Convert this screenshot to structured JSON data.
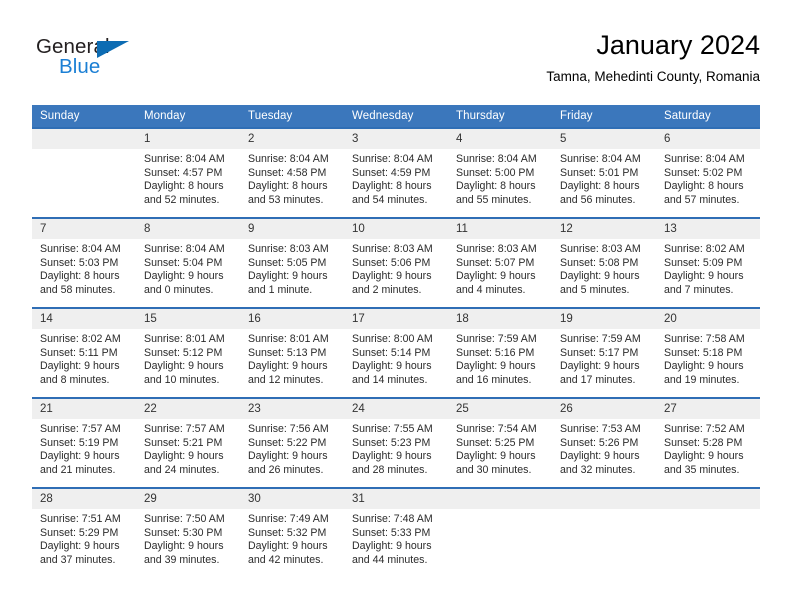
{
  "brand": {
    "name_part1": "General",
    "name_part2": "Blue",
    "triangle_color": "#0d6cb3",
    "blue_color": "#1b7fd4"
  },
  "header": {
    "title": "January 2024",
    "subtitle": "Tamna, Mehedinti County, Romania"
  },
  "theme": {
    "header_band": "#3b77bc",
    "row_rule": "#2f6eb5",
    "daynum_band": "#efefef"
  },
  "weekday_headers": [
    "Sunday",
    "Monday",
    "Tuesday",
    "Wednesday",
    "Thursday",
    "Friday",
    "Saturday"
  ],
  "weeks": [
    [
      {
        "day": "",
        "sunrise": "",
        "sunset": "",
        "daylight1": "",
        "daylight2": "",
        "empty": true
      },
      {
        "day": "1",
        "sunrise": "Sunrise: 8:04 AM",
        "sunset": "Sunset: 4:57 PM",
        "daylight1": "Daylight: 8 hours",
        "daylight2": "and 52 minutes."
      },
      {
        "day": "2",
        "sunrise": "Sunrise: 8:04 AM",
        "sunset": "Sunset: 4:58 PM",
        "daylight1": "Daylight: 8 hours",
        "daylight2": "and 53 minutes."
      },
      {
        "day": "3",
        "sunrise": "Sunrise: 8:04 AM",
        "sunset": "Sunset: 4:59 PM",
        "daylight1": "Daylight: 8 hours",
        "daylight2": "and 54 minutes."
      },
      {
        "day": "4",
        "sunrise": "Sunrise: 8:04 AM",
        "sunset": "Sunset: 5:00 PM",
        "daylight1": "Daylight: 8 hours",
        "daylight2": "and 55 minutes."
      },
      {
        "day": "5",
        "sunrise": "Sunrise: 8:04 AM",
        "sunset": "Sunset: 5:01 PM",
        "daylight1": "Daylight: 8 hours",
        "daylight2": "and 56 minutes."
      },
      {
        "day": "6",
        "sunrise": "Sunrise: 8:04 AM",
        "sunset": "Sunset: 5:02 PM",
        "daylight1": "Daylight: 8 hours",
        "daylight2": "and 57 minutes."
      }
    ],
    [
      {
        "day": "7",
        "sunrise": "Sunrise: 8:04 AM",
        "sunset": "Sunset: 5:03 PM",
        "daylight1": "Daylight: 8 hours",
        "daylight2": "and 58 minutes."
      },
      {
        "day": "8",
        "sunrise": "Sunrise: 8:04 AM",
        "sunset": "Sunset: 5:04 PM",
        "daylight1": "Daylight: 9 hours",
        "daylight2": "and 0 minutes."
      },
      {
        "day": "9",
        "sunrise": "Sunrise: 8:03 AM",
        "sunset": "Sunset: 5:05 PM",
        "daylight1": "Daylight: 9 hours",
        "daylight2": "and 1 minute."
      },
      {
        "day": "10",
        "sunrise": "Sunrise: 8:03 AM",
        "sunset": "Sunset: 5:06 PM",
        "daylight1": "Daylight: 9 hours",
        "daylight2": "and 2 minutes."
      },
      {
        "day": "11",
        "sunrise": "Sunrise: 8:03 AM",
        "sunset": "Sunset: 5:07 PM",
        "daylight1": "Daylight: 9 hours",
        "daylight2": "and 4 minutes."
      },
      {
        "day": "12",
        "sunrise": "Sunrise: 8:03 AM",
        "sunset": "Sunset: 5:08 PM",
        "daylight1": "Daylight: 9 hours",
        "daylight2": "and 5 minutes."
      },
      {
        "day": "13",
        "sunrise": "Sunrise: 8:02 AM",
        "sunset": "Sunset: 5:09 PM",
        "daylight1": "Daylight: 9 hours",
        "daylight2": "and 7 minutes."
      }
    ],
    [
      {
        "day": "14",
        "sunrise": "Sunrise: 8:02 AM",
        "sunset": "Sunset: 5:11 PM",
        "daylight1": "Daylight: 9 hours",
        "daylight2": "and 8 minutes."
      },
      {
        "day": "15",
        "sunrise": "Sunrise: 8:01 AM",
        "sunset": "Sunset: 5:12 PM",
        "daylight1": "Daylight: 9 hours",
        "daylight2": "and 10 minutes."
      },
      {
        "day": "16",
        "sunrise": "Sunrise: 8:01 AM",
        "sunset": "Sunset: 5:13 PM",
        "daylight1": "Daylight: 9 hours",
        "daylight2": "and 12 minutes."
      },
      {
        "day": "17",
        "sunrise": "Sunrise: 8:00 AM",
        "sunset": "Sunset: 5:14 PM",
        "daylight1": "Daylight: 9 hours",
        "daylight2": "and 14 minutes."
      },
      {
        "day": "18",
        "sunrise": "Sunrise: 7:59 AM",
        "sunset": "Sunset: 5:16 PM",
        "daylight1": "Daylight: 9 hours",
        "daylight2": "and 16 minutes."
      },
      {
        "day": "19",
        "sunrise": "Sunrise: 7:59 AM",
        "sunset": "Sunset: 5:17 PM",
        "daylight1": "Daylight: 9 hours",
        "daylight2": "and 17 minutes."
      },
      {
        "day": "20",
        "sunrise": "Sunrise: 7:58 AM",
        "sunset": "Sunset: 5:18 PM",
        "daylight1": "Daylight: 9 hours",
        "daylight2": "and 19 minutes."
      }
    ],
    [
      {
        "day": "21",
        "sunrise": "Sunrise: 7:57 AM",
        "sunset": "Sunset: 5:19 PM",
        "daylight1": "Daylight: 9 hours",
        "daylight2": "and 21 minutes."
      },
      {
        "day": "22",
        "sunrise": "Sunrise: 7:57 AM",
        "sunset": "Sunset: 5:21 PM",
        "daylight1": "Daylight: 9 hours",
        "daylight2": "and 24 minutes."
      },
      {
        "day": "23",
        "sunrise": "Sunrise: 7:56 AM",
        "sunset": "Sunset: 5:22 PM",
        "daylight1": "Daylight: 9 hours",
        "daylight2": "and 26 minutes."
      },
      {
        "day": "24",
        "sunrise": "Sunrise: 7:55 AM",
        "sunset": "Sunset: 5:23 PM",
        "daylight1": "Daylight: 9 hours",
        "daylight2": "and 28 minutes."
      },
      {
        "day": "25",
        "sunrise": "Sunrise: 7:54 AM",
        "sunset": "Sunset: 5:25 PM",
        "daylight1": "Daylight: 9 hours",
        "daylight2": "and 30 minutes."
      },
      {
        "day": "26",
        "sunrise": "Sunrise: 7:53 AM",
        "sunset": "Sunset: 5:26 PM",
        "daylight1": "Daylight: 9 hours",
        "daylight2": "and 32 minutes."
      },
      {
        "day": "27",
        "sunrise": "Sunrise: 7:52 AM",
        "sunset": "Sunset: 5:28 PM",
        "daylight1": "Daylight: 9 hours",
        "daylight2": "and 35 minutes."
      }
    ],
    [
      {
        "day": "28",
        "sunrise": "Sunrise: 7:51 AM",
        "sunset": "Sunset: 5:29 PM",
        "daylight1": "Daylight: 9 hours",
        "daylight2": "and 37 minutes."
      },
      {
        "day": "29",
        "sunrise": "Sunrise: 7:50 AM",
        "sunset": "Sunset: 5:30 PM",
        "daylight1": "Daylight: 9 hours",
        "daylight2": "and 39 minutes."
      },
      {
        "day": "30",
        "sunrise": "Sunrise: 7:49 AM",
        "sunset": "Sunset: 5:32 PM",
        "daylight1": "Daylight: 9 hours",
        "daylight2": "and 42 minutes."
      },
      {
        "day": "31",
        "sunrise": "Sunrise: 7:48 AM",
        "sunset": "Sunset: 5:33 PM",
        "daylight1": "Daylight: 9 hours",
        "daylight2": "and 44 minutes."
      },
      {
        "day": "",
        "sunrise": "",
        "sunset": "",
        "daylight1": "",
        "daylight2": "",
        "empty": true
      },
      {
        "day": "",
        "sunrise": "",
        "sunset": "",
        "daylight1": "",
        "daylight2": "",
        "empty": true
      },
      {
        "day": "",
        "sunrise": "",
        "sunset": "",
        "daylight1": "",
        "daylight2": "",
        "empty": true
      }
    ]
  ]
}
